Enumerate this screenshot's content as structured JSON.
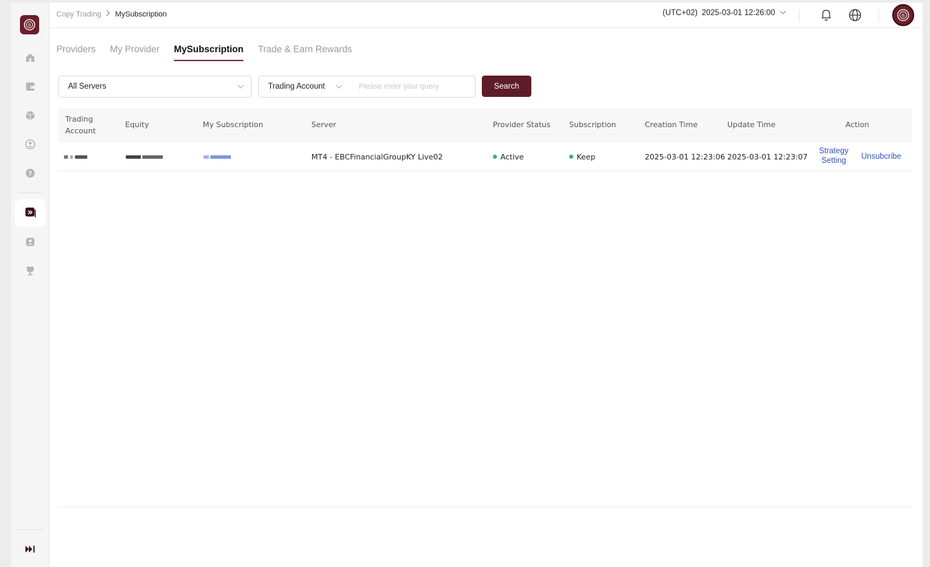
{
  "breadcrumb": {
    "root": "Copy Trading",
    "current": "MySubscription"
  },
  "header": {
    "timezone": "(UTC+02)",
    "datetime": "2025-03-01 12:26:00"
  },
  "tabs": [
    {
      "label": "Providers",
      "active": false
    },
    {
      "label": "My Provider",
      "active": false
    },
    {
      "label": "MySubscription",
      "active": true
    },
    {
      "label": "Trade & Earn Rewards",
      "active": false
    }
  ],
  "filters": {
    "server_select": "All Servers",
    "field_select": "Trading Account",
    "search_placeholder": "Please enter your query",
    "search_button": "Search"
  },
  "table": {
    "columns": {
      "trading_account": "Trading Account",
      "equity": "Equity",
      "my_subscription": "My Subscription",
      "server": "Server",
      "provider_status": "Provider Status",
      "subscription": "Subscription",
      "creation_time": "Creation Time",
      "update_time": "Update Time",
      "action": "Action"
    },
    "rows": [
      {
        "server": "MT4 - EBCFinancialGroupKY Live02",
        "provider_status": "Active",
        "subscription": "Keep",
        "creation_time": "2025-03-01 12:23:06",
        "update_time": "2025-03-01 12:23:07",
        "action_strategy": "Strategy Setting",
        "action_unsubscribe": "Unsubcribe"
      }
    ]
  },
  "colors": {
    "brand": "#6b1e2a",
    "button": "#5e1c28",
    "link": "#2f53b8",
    "status_green": "#3cb371",
    "tab_underline": "#8a2a3a"
  }
}
